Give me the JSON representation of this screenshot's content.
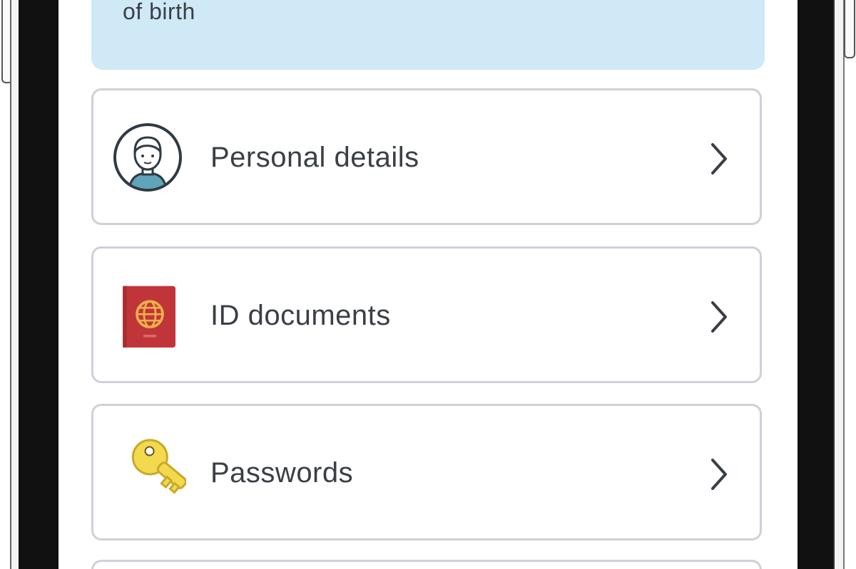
{
  "banner": {
    "text": "of birth"
  },
  "menu": {
    "items": [
      {
        "label": "Personal details",
        "icon": "person-avatar-icon"
      },
      {
        "label": "ID documents",
        "icon": "passport-icon"
      },
      {
        "label": "Passwords",
        "icon": "key-icon"
      }
    ]
  },
  "colors": {
    "banner_bg": "#cfe9f6",
    "card_border": "#cdd1d8",
    "text": "#3a3f47",
    "passport_red": "#c0353a",
    "key_yellow": "#f2d94e"
  }
}
